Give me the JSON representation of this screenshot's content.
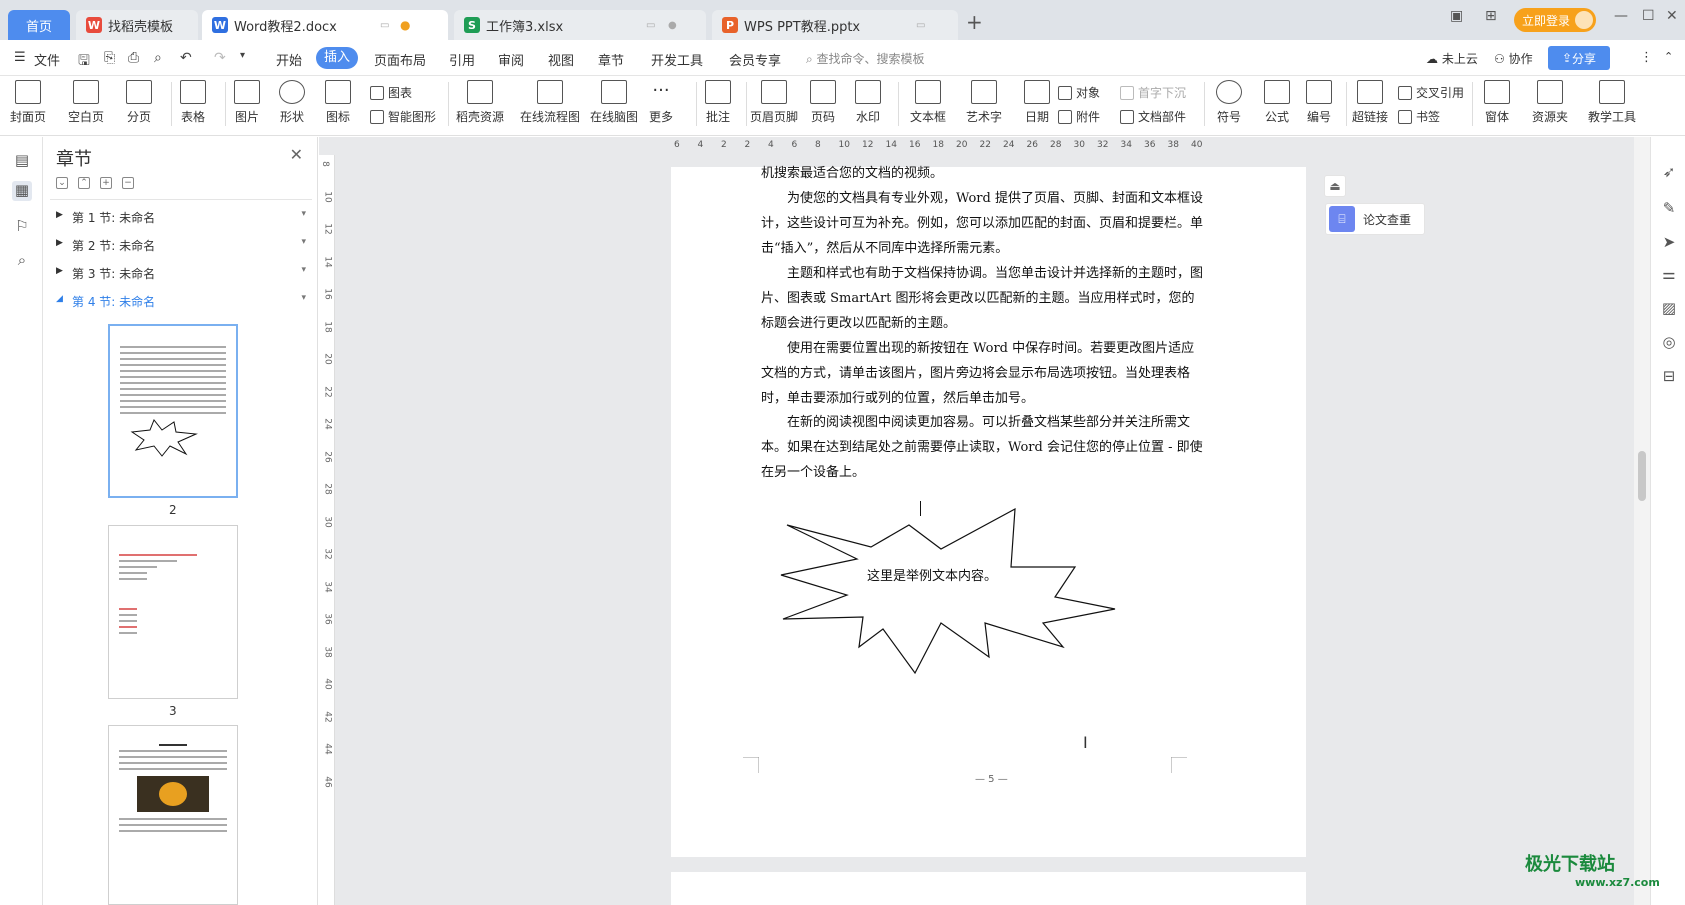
{
  "tabs": {
    "home": "首页",
    "template": "找稻壳模板",
    "doc": "Word教程2.docx",
    "xlsx": "工作簿3.xlsx",
    "ppt": "WPS PPT教程.pptx",
    "add": "+"
  },
  "title_controls": {
    "login": "立即登录"
  },
  "menu": {
    "file": "文件",
    "items": [
      "开始",
      "插入",
      "页面布局",
      "引用",
      "审阅",
      "视图",
      "章节",
      "开发工具",
      "会员专享"
    ],
    "search_placeholder": "查找命令、搜索模板",
    "cloud": "未上云",
    "collab": "协作",
    "share": "分享"
  },
  "ribbon": {
    "cover": "封面页",
    "blank": "空白页",
    "pagebreak": "分页",
    "table": "表格",
    "picture": "图片",
    "shape": "形状",
    "icon": "图标",
    "chart": "图表",
    "smartart": "智能图形",
    "docer": "稻壳资源",
    "flowchart": "在线流程图",
    "mindmap": "在线脑图",
    "more": "更多",
    "comment": "批注",
    "header_footer": "页眉页脚",
    "page_number": "页码",
    "watermark": "水印",
    "textbox": "文本框",
    "wordart": "艺术字",
    "date": "日期",
    "object": "对象",
    "attachment": "附件",
    "dropcap": "首字下沉",
    "docparts": "文档部件",
    "symbol": "符号",
    "formula": "公式",
    "numbering": "编号",
    "hyperlink": "超链接",
    "crossref": "交叉引用",
    "bookmark": "书签",
    "window": "窗体",
    "resources": "资源夹",
    "teaching": "教学工具"
  },
  "nav": {
    "title": "章节",
    "sections": [
      "第 1 节: 未命名",
      "第 2 节: 未命名",
      "第 3 节: 未命名",
      "第 4 节: 未命名"
    ],
    "thumb_numbers": [
      "2",
      "3"
    ]
  },
  "ruler": {
    "h": [
      "6",
      "4",
      "2",
      "2",
      "4",
      "6",
      "8",
      "10",
      "12",
      "14",
      "16",
      "18",
      "20",
      "22",
      "24",
      "26",
      "28",
      "30",
      "32",
      "34",
      "36",
      "38",
      "40"
    ],
    "v": [
      "8",
      "10",
      "12",
      "14",
      "16",
      "18",
      "20",
      "22",
      "24",
      "26",
      "28",
      "30",
      "32",
      "34",
      "36",
      "38",
      "40",
      "42",
      "44",
      "46"
    ]
  },
  "document": {
    "paragraphs": [
      "机搜索最适合您的文档的视频。",
      "为使您的文档具有专业外观，Word 提供了页眉、页脚、封面和文本框设计，这些设计可互为补充。例如，您可以添加匹配的封面、页眉和提要栏。单击“插入”，然后从不同库中选择所需元素。",
      "主题和样式也有助于文档保持协调。当您单击设计并选择新的主题时，图片、图表或 SmartArt 图形将会更改以匹配新的主题。当应用样式时，您的标题会进行更改以匹配新的主题。",
      "使用在需要位置出现的新按钮在 Word 中保存时间。若要更改图片适应文档的方式，请单击该图片，图片旁边将会显示布局选项按钮。当处理表格时，单击要添加行或列的位置，然后单击加号。",
      "在新的阅读视图中阅读更加容易。可以折叠文档某些部分并关注所需文本。如果在达到结尾处之前需要停止读取，Word 会记住您的停止位置 - 即使在另一个设备上。"
    ],
    "shape_text": "这里是举例文本内容。",
    "page_number": "— 5 —"
  },
  "side_panel": {
    "thesis_check": "论文查重"
  },
  "watermark": {
    "brand": "极光下载站",
    "url": "www.xz7.com"
  }
}
